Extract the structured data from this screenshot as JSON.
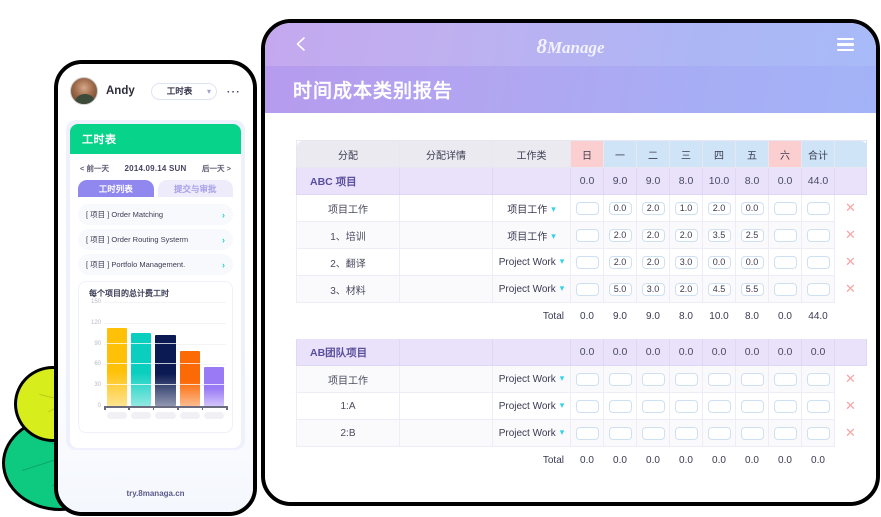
{
  "tablet": {
    "brand_mark": "8",
    "brand_name": "Manage",
    "back_icon": "chevron-left-icon",
    "menu_icon": "hamburger-menu-icon",
    "page_title": "时间成本类别报告",
    "table": {
      "headers": [
        "分配",
        "分配详情",
        "工作类",
        "日",
        "一",
        "二",
        "三",
        "四",
        "五",
        "六",
        "合计",
        ""
      ],
      "total_label": "Total",
      "delete_icon": "close-x-icon",
      "dropdown_icon": "chevron-down-icon",
      "groups": [
        {
          "name": "ABC 项目",
          "detail": "",
          "worktype": "",
          "values": [
            "0.0",
            "9.0",
            "9.0",
            "8.0",
            "10.0",
            "8.0",
            "0.0",
            "44.0"
          ],
          "rows": [
            {
              "name": "项目工作",
              "detail": "",
              "worktype": "项目工作",
              "values": [
                "",
                "0.0",
                "2.0",
                "1.0",
                "2.0",
                "0.0",
                "",
                ""
              ]
            },
            {
              "name": "1、培训",
              "detail": "",
              "worktype": "项目工作",
              "values": [
                "",
                "2.0",
                "2.0",
                "2.0",
                "3.5",
                "2.5",
                "",
                ""
              ]
            },
            {
              "name": "2、翻译",
              "detail": "",
              "worktype": "Project Work",
              "values": [
                "",
                "2.0",
                "2.0",
                "3.0",
                "0.0",
                "0.0",
                "",
                ""
              ]
            },
            {
              "name": "3、材料",
              "detail": "",
              "worktype": "Project Work",
              "values": [
                "",
                "5.0",
                "3.0",
                "2.0",
                "4.5",
                "5.5",
                "",
                ""
              ]
            }
          ],
          "totals": [
            "0.0",
            "9.0",
            "9.0",
            "8.0",
            "10.0",
            "8.0",
            "0.0",
            "44.0"
          ]
        },
        {
          "name": "AB团队项目",
          "detail": "",
          "worktype": "",
          "values": [
            "0.0",
            "0.0",
            "0.0",
            "0.0",
            "0.0",
            "0.0",
            "0.0",
            "0.0"
          ],
          "rows": [
            {
              "name": "项目工作",
              "detail": "",
              "worktype": "Project Work",
              "values": [
                "",
                "",
                "",
                "",
                "",
                "",
                "",
                ""
              ]
            },
            {
              "name": "1:A",
              "detail": "",
              "worktype": "Project Work",
              "values": [
                "",
                "",
                "",
                "",
                "",
                "",
                "",
                ""
              ]
            },
            {
              "name": "2:B",
              "detail": "",
              "worktype": "Project Work",
              "values": [
                "",
                "",
                "",
                "",
                "",
                "",
                "",
                ""
              ]
            }
          ],
          "totals": [
            "0.0",
            "0.0",
            "0.0",
            "0.0",
            "0.0",
            "0.0",
            "0.0",
            "0.0"
          ]
        }
      ]
    }
  },
  "phone": {
    "user_name": "Andy",
    "avatar": "user-avatar",
    "sheet_select_value": "工时表",
    "sheet_select_icon": "chevron-down-icon",
    "more_icon": "more-options-icon",
    "card_title": "工时表",
    "date_nav": {
      "prev_label": "< 前一天",
      "current": "2014.09.14 SUN",
      "next_label": "后一天 >"
    },
    "tabs": [
      {
        "label": "工时列表",
        "active": true
      },
      {
        "label": "提交与审批",
        "active": false
      }
    ],
    "projects": [
      {
        "label": "[ 项目 ] Order Matching",
        "chevron": "chevron-right-icon"
      },
      {
        "label": "[ 项目 ] Order Routing Systerm",
        "chevron": "chevron-right-icon"
      },
      {
        "label": "[ 项目 ] Portfolo Management.",
        "chevron": "chevron-right-icon"
      }
    ],
    "url": "try.8managa.cn"
  },
  "chart_data": {
    "type": "bar",
    "title": "每个项目的总计费工时",
    "xlabel": "",
    "ylabel": "",
    "ylim": [
      0,
      150
    ],
    "yticks": [
      0,
      30,
      60,
      90,
      120,
      150
    ],
    "grid": true,
    "categories": [
      "",
      "",
      "",
      "",
      ""
    ],
    "values": [
      112,
      105,
      102,
      79,
      56
    ],
    "colors": [
      "#FFC107",
      "#0ACFBF",
      "#0B1A52",
      "#FB6A07",
      "#9B7BF5"
    ],
    "legend": "none"
  },
  "theme": {
    "brand_purple": "#9087ef",
    "header_gradient_start": "#b69bee",
    "header_gradient_end": "#a3b3f7",
    "green_accent": "#07d38a",
    "weekend_header": "#fbcfcf",
    "weekday_header": "#cfe4f7",
    "group_row": "#eae2fb",
    "teal_chevron": "#22d3c5",
    "delete_red": "#f8a5a5"
  }
}
